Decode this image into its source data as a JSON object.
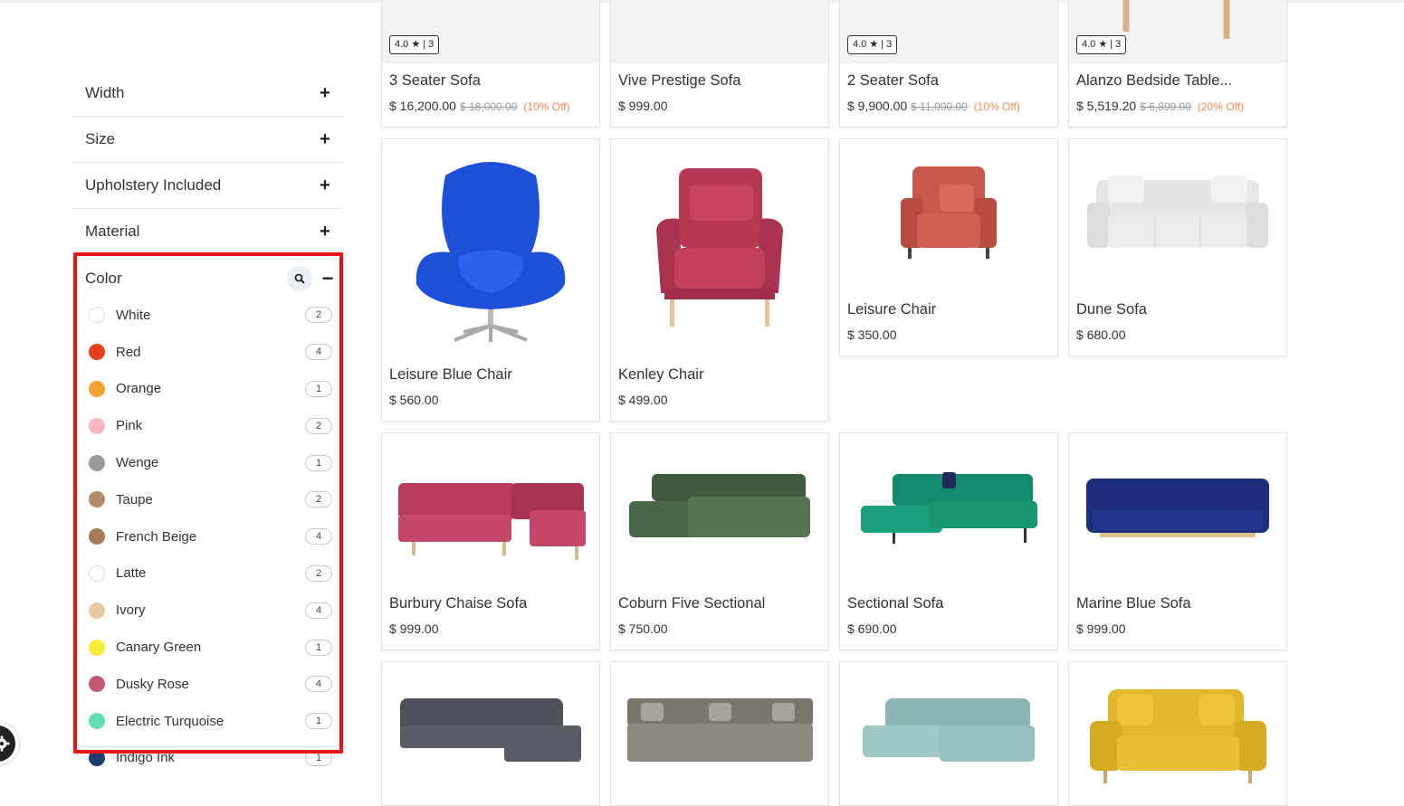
{
  "filters": {
    "facets": [
      {
        "label": "Width"
      },
      {
        "label": "Size"
      },
      {
        "label": "Upholstery Included"
      },
      {
        "label": "Material"
      }
    ],
    "color": {
      "label": "Color",
      "options": [
        {
          "label": "White",
          "count": "2",
          "hex": "#ffffff"
        },
        {
          "label": "Red",
          "count": "4",
          "hex": "#e8401c"
        },
        {
          "label": "Orange",
          "count": "1",
          "hex": "#f5a033"
        },
        {
          "label": "Pink",
          "count": "2",
          "hex": "#f7b8c4"
        },
        {
          "label": "Wenge",
          "count": "1",
          "hex": "#9a9a9a"
        },
        {
          "label": "Taupe",
          "count": "2",
          "hex": "#b48b6a"
        },
        {
          "label": "French Beige",
          "count": "4",
          "hex": "#a57b5a"
        },
        {
          "label": "Latte",
          "count": "2",
          "hex": "#ffffff"
        },
        {
          "label": "Ivory",
          "count": "4",
          "hex": "#e9c8a0"
        },
        {
          "label": "Canary Green",
          "count": "1",
          "hex": "#f5ec3a"
        },
        {
          "label": "Dusky Rose",
          "count": "4",
          "hex": "#c25a72"
        },
        {
          "label": "Electric Turquoise",
          "count": "1",
          "hex": "#5fe0b2"
        },
        {
          "label": "Indigo Ink",
          "count": "1",
          "hex": "#1f3d6b"
        }
      ]
    }
  },
  "products": {
    "row1": [
      {
        "rating": "4.0 ★ | 3",
        "name": "3 Seater Sofa",
        "price": "$ 16,200.00",
        "old": "$ 18,000.00",
        "off": "(10% Off)"
      },
      {
        "rating": "",
        "name": "Vive Prestige Sofa",
        "price": "$ 999.00",
        "old": "",
        "off": ""
      },
      {
        "rating": "4.0 ★ | 3",
        "name": "2 Seater Sofa",
        "price": "$ 9,900.00",
        "old": "$ 11,000.00",
        "off": "(10% Off)"
      },
      {
        "rating": "4.0 ★ | 3",
        "name": "Alanzo Bedside Table...",
        "price": "$ 5,519.20",
        "old": "$ 6,899.00",
        "off": "(20% Off)"
      }
    ],
    "row2": [
      {
        "name": "Leisure Blue Chair",
        "price": "$ 560.00",
        "image": "blue-egg-chair"
      },
      {
        "name": "Kenley Chair",
        "price": "$ 499.00",
        "image": "pink-armchair"
      },
      {
        "name": "Leisure Chair",
        "price": "$ 350.00",
        "image": "coral-armchair"
      },
      {
        "name": "Dune Sofa",
        "price": "$ 680.00",
        "image": "white-sofa"
      }
    ],
    "row3": [
      {
        "name": "Burbury Chaise Sofa",
        "price": "$ 999.00",
        "image": "pink-corner-sofa"
      },
      {
        "name": "Coburn Five Sectional",
        "price": "$ 750.00",
        "image": "green-sectional"
      },
      {
        "name": "Sectional Sofa",
        "price": "$ 690.00",
        "image": "teal-sectional"
      },
      {
        "name": "Marine Blue Sofa",
        "price": "$ 999.00",
        "image": "navy-tufted-sofa"
      }
    ],
    "row4": [
      {
        "image": "gray-sleeper-sectional"
      },
      {
        "image": "gray-modular-sofa"
      },
      {
        "image": "mint-corner-sofa"
      },
      {
        "image": "yellow-loveseat"
      }
    ]
  }
}
